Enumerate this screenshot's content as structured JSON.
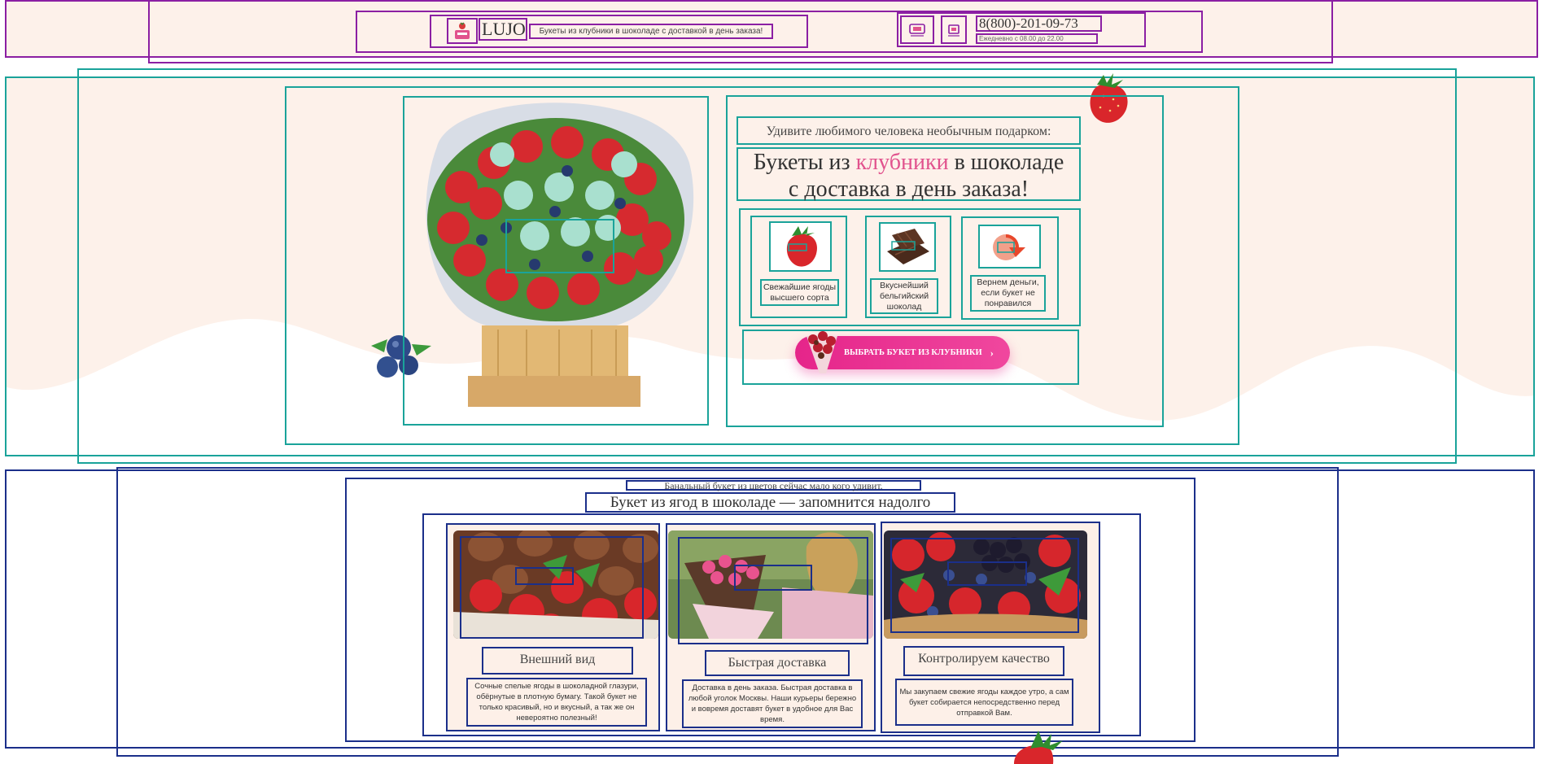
{
  "header": {
    "logo_text": "LUJO",
    "tagline": "Букеты из клубники в шоколаде с доставкой в день заказа!",
    "phone": "8(800)-201-09-73",
    "hours": "Ежедневно с 08.00 до 22.00",
    "btn_a_label": "Войти",
    "btn_b_label": "Корзина"
  },
  "hero": {
    "subtitle": "Удивите любимого человека необычным подарком:",
    "title_part1": "Букеты из ",
    "title_accent": "клубники",
    "title_part2": " в шоколаде",
    "title_line2": "с доставка в день заказа!",
    "accent_color": "#e1528d",
    "features": [
      {
        "icon": "strawberry-icon",
        "text": "Свежайшие ягоды высшего сорта"
      },
      {
        "icon": "chocolate-icon",
        "text": "Вкуснейший бельгийский шоколад"
      },
      {
        "icon": "refund-icon",
        "text": "Вернем деньги, если букет не понравился"
      }
    ],
    "cta_label": "ВЫБРАТЬ БУКЕТ ИЗ КЛУБНИКИ",
    "cta_arrow": "›",
    "cta_color": "#e5258a"
  },
  "section2": {
    "pre_title": "Банальный букет из цветов сейчас мало кого удивит.",
    "title": "Букет из ягод в шоколаде — запомнится надолго",
    "cards": [
      {
        "title": "Внешний вид",
        "text": "Сочные спелые ягоды в шоколадной глазури, обёрнутые в плотную бумагу. Такой букет не только красивый, но и вкусный, а так же он невероятно полезный!"
      },
      {
        "title": "Быстрая доставка",
        "text": "Доставка в день заказа. Быстрая доставка в любой уголок Москвы. Наши курьеры бережно и вовремя доставят букет в удобное для Вас время."
      },
      {
        "title": "Контролируем качество",
        "text": "Мы закупаем свежие ягоды каждое утро, а сам букет собирается непосредственно перед отправкой Вам."
      }
    ]
  }
}
